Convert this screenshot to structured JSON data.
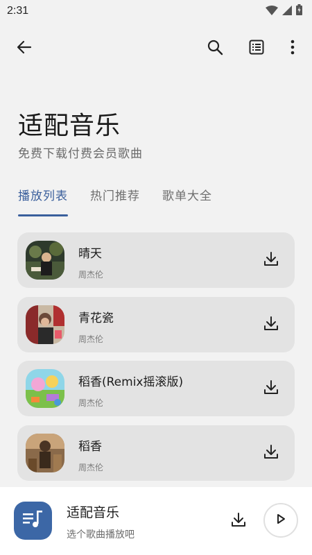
{
  "status_bar": {
    "time": "2:31",
    "icons": [
      "wifi-icon",
      "cell-signal-icon",
      "battery-icon"
    ]
  },
  "app_bar": {
    "back_icon": "arrow-back-icon",
    "search_icon": "search-icon",
    "list_icon": "list-view-icon",
    "more_icon": "more-vert-icon"
  },
  "hero": {
    "title": "适配音乐",
    "subtitle": "免费下载付费会员歌曲"
  },
  "tabs": [
    {
      "label": "播放列表",
      "active": true
    },
    {
      "label": "热门推荐",
      "active": false
    },
    {
      "label": "歌单大全",
      "active": false
    }
  ],
  "songs": [
    {
      "title": "晴天",
      "artist": "周杰伦",
      "download_icon": "download-icon"
    },
    {
      "title": "青花瓷",
      "artist": "周杰伦",
      "download_icon": "download-icon"
    },
    {
      "title": "稻香(Remix摇滚版)",
      "artist": "周杰伦",
      "download_icon": "download-icon"
    },
    {
      "title": "稻香",
      "artist": "周杰伦",
      "download_icon": "download-icon"
    }
  ],
  "player": {
    "title": "适配音乐",
    "subtitle": "选个歌曲播放吧",
    "art_icon": "music-queue-icon",
    "download_icon": "download-icon",
    "play_icon": "play-icon"
  },
  "colors": {
    "background": "#f2f2f2",
    "card": "#e3e3e3",
    "accent": "#3a5f9c",
    "player_art": "#3c67a6"
  }
}
